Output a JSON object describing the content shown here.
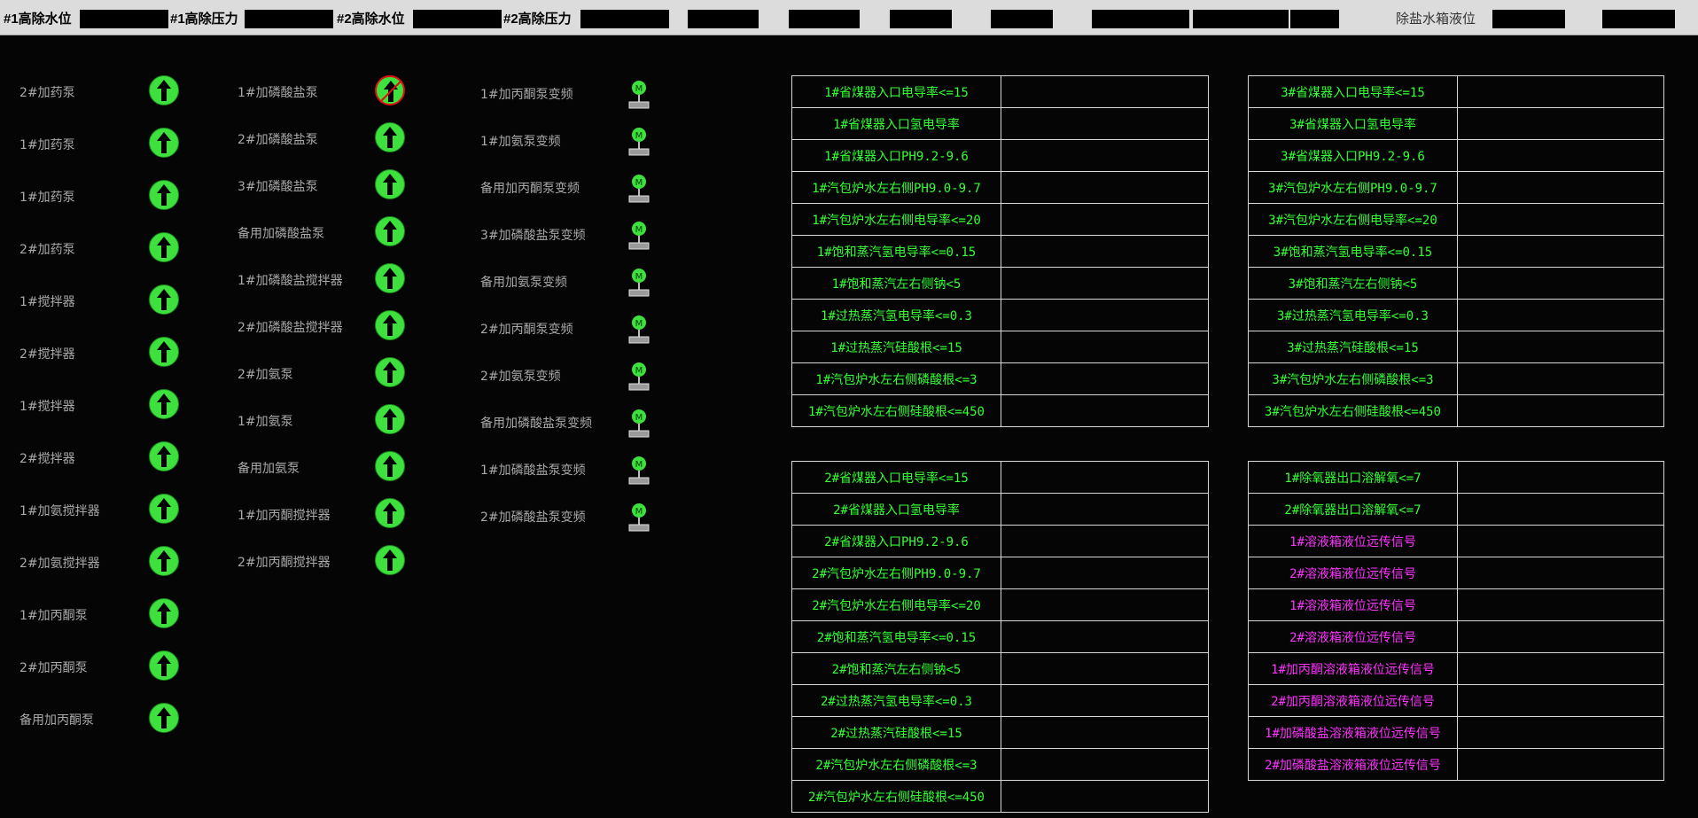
{
  "topbar": {
    "labels": [
      "#1高除水位",
      "#1高除压力",
      "#2高除水位",
      "#2高除压力",
      "除盐水箱液位"
    ]
  },
  "col1": [
    "2#加药泵",
    "1#加药泵",
    "1#加药泵",
    "2#加药泵",
    "1#搅拌器",
    "2#搅拌器",
    "1#搅拌器",
    "2#搅拌器",
    "1#加氨搅拌器",
    "2#加氨搅拌器",
    "1#加丙酮泵",
    "2#加丙酮泵",
    "备用加丙酮泵"
  ],
  "col2": [
    "1#加磷酸盐泵",
    "2#加磷酸盐泵",
    "3#加磷酸盐泵",
    "备用加磷酸盐泵",
    "1#加磷酸盐搅拌器",
    "2#加磷酸盐搅拌器",
    "2#加氨泵",
    "1#加氨泵",
    "备用加氨泵",
    "1#加丙酮搅拌器",
    "2#加丙酮搅拌器"
  ],
  "col3": [
    "1#加丙酮泵变频",
    "1#加氨泵变频",
    "备用加丙酮泵变频",
    "3#加磷酸盐泵变频",
    "备用加氨泵变频",
    "2#加丙酮泵变频",
    "2#加氨泵变频",
    "备用加磷酸盐泵变频",
    "1#加磷酸盐泵变频",
    "2#加磷酸盐泵变频"
  ],
  "motor_letter": "M",
  "status_colors": {
    "running": "#3ee03e",
    "fault": "#e01010",
    "param_text": "#33ff33",
    "signal_text": "#ff33ff"
  },
  "table1": [
    "1#省煤器入口电导率<=15",
    "1#省煤器入口氢电导率",
    "1#省煤器入口PH9.2-9.6",
    "1#汽包炉水左右侧PH9.0-9.7",
    "1#汽包炉水左右侧电导率<=20",
    "1#饱和蒸汽氢电导率<=0.15",
    "1#饱和蒸汽左右侧钠<5",
    "1#过热蒸汽氢电导率<=0.3",
    "1#过热蒸汽硅酸根<=15",
    "1#汽包炉水左右侧磷酸根<=3",
    "1#汽包炉水左右侧硅酸根<=450"
  ],
  "table2": [
    "3#省煤器入口电导率<=15",
    "3#省煤器入口氢电导率",
    "3#省煤器入口PH9.2-9.6",
    "3#汽包炉水左右侧PH9.0-9.7",
    "3#汽包炉水左右侧电导率<=20",
    "3#饱和蒸汽氢电导率<=0.15",
    "3#饱和蒸汽左右侧钠<5",
    "3#过热蒸汽氢电导率<=0.3",
    "3#过热蒸汽硅酸根<=15",
    "3#汽包炉水左右侧磷酸根<=3",
    "3#汽包炉水左右侧硅酸根<=450"
  ],
  "table3": [
    "2#省煤器入口电导率<=15",
    "2#省煤器入口氢电导率",
    "2#省煤器入口PH9.2-9.6",
    "2#汽包炉水左右侧PH9.0-9.7",
    "2#汽包炉水左右侧电导率<=20",
    "2#饱和蒸汽氢电导率<=0.15",
    "2#饱和蒸汽左右侧钠<5",
    "2#过热蒸汽氢电导率<=0.3",
    "2#过热蒸汽硅酸根<=15",
    "2#汽包炉水左右侧磷酸根<=3",
    "2#汽包炉水左右侧硅酸根<=450"
  ],
  "table4": [
    "1#除氧器出口溶解氧<=7",
    "2#除氧器出口溶解氧<=7",
    "1#溶液箱液位远传信号",
    "2#溶液箱液位远传信号",
    "1#溶液箱液位远传信号",
    "2#溶液箱液位远传信号",
    "1#加丙酮溶液箱液位远传信号",
    "2#加丙酮溶液箱液位远传信号",
    "1#加磷酸盐溶液箱液位远传信号",
    "2#加磷酸盐溶液箱液位远传信号"
  ]
}
